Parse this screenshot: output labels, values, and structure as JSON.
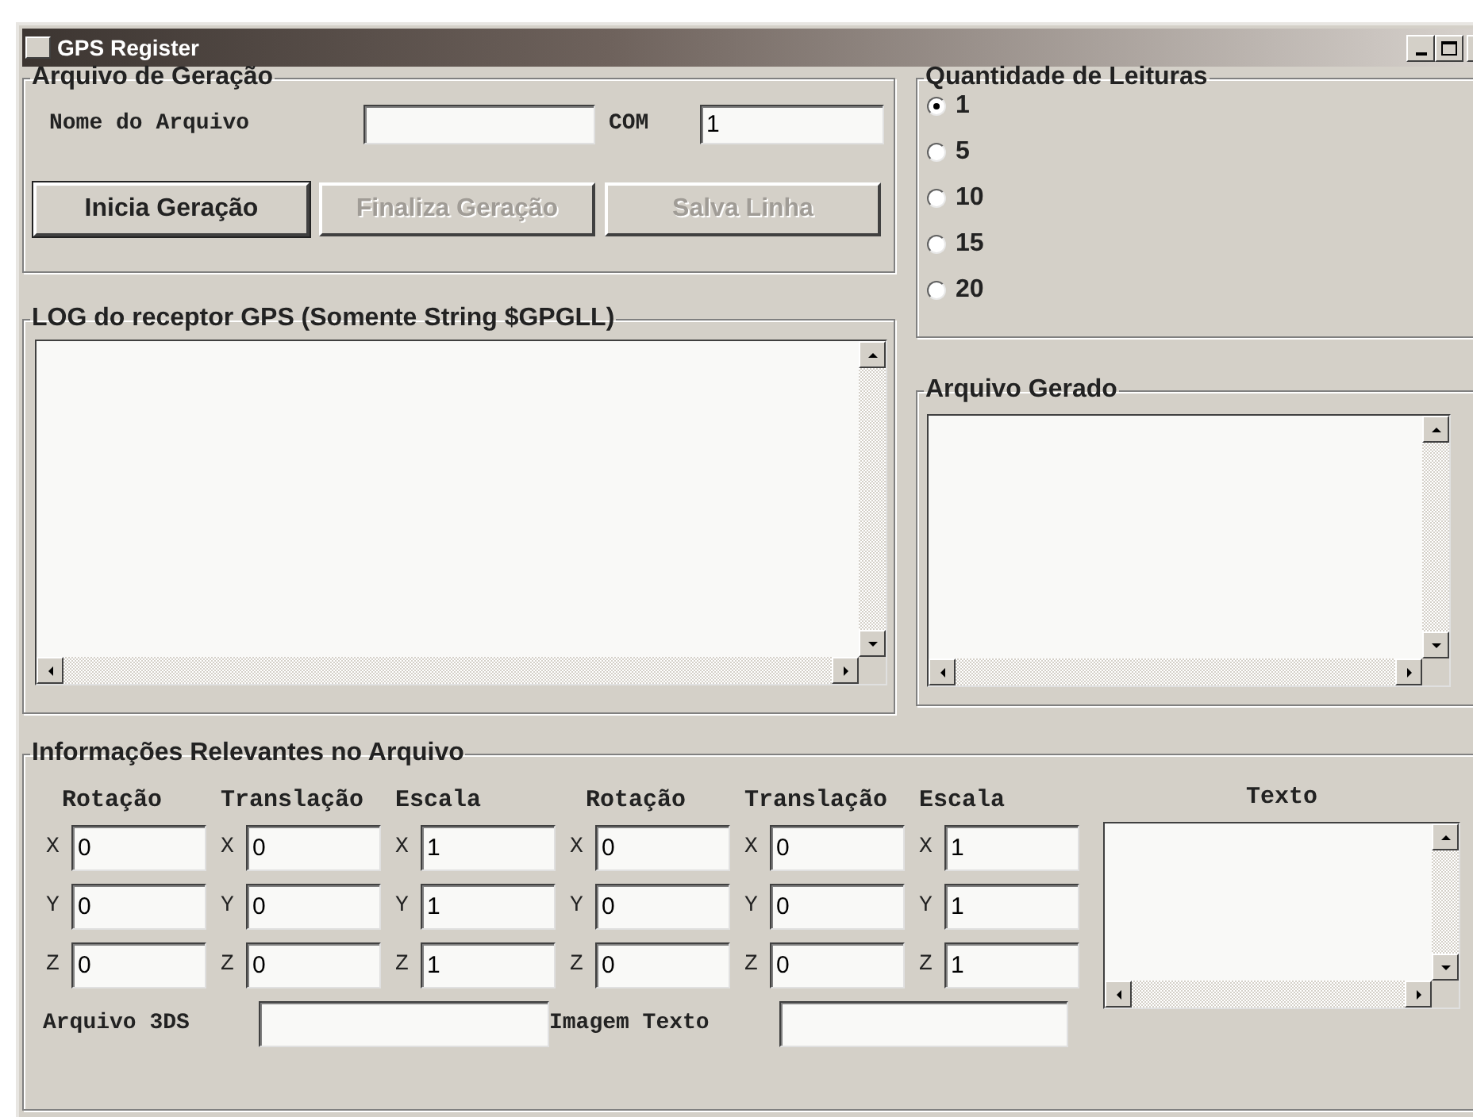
{
  "window": {
    "title": "GPS Register"
  },
  "generation": {
    "title": "Arquivo de Geração",
    "file_name_label": "Nome do Arquivo",
    "com_label": "COM",
    "com_value": "1",
    "buttons": [
      {
        "label": "Inicia Geração",
        "disabled": false
      },
      {
        "label": "Finaliza Geração",
        "disabled": true
      },
      {
        "label": "Salva Linha",
        "disabled": true
      }
    ]
  },
  "log": {
    "title": "LOG do receptor GPS (Somente String $GPGLL)"
  },
  "readings": {
    "title": "Quantidade de Leituras",
    "options": [
      {
        "label": "1",
        "selected": true
      },
      {
        "label": "5",
        "selected": false
      },
      {
        "label": "10",
        "selected": false
      },
      {
        "label": "15",
        "selected": false
      },
      {
        "label": "20",
        "selected": false
      }
    ]
  },
  "generated_file": {
    "title": "Arquivo Gerado"
  },
  "info": {
    "title": "Informações Relevantes no Arquivo",
    "columns": [
      {
        "header": "Rotação",
        "fields": [
          {
            "axis": "X",
            "value": "0"
          },
          {
            "axis": "Y",
            "value": "0"
          },
          {
            "axis": "Z",
            "value": "0"
          }
        ]
      },
      {
        "header": "Translação",
        "fields": [
          {
            "axis": "X",
            "value": "0"
          },
          {
            "axis": "Y",
            "value": "0"
          },
          {
            "axis": "Z",
            "value": "0"
          }
        ]
      },
      {
        "header": "Escala",
        "fields": [
          {
            "axis": "X",
            "value": "1"
          },
          {
            "axis": "Y",
            "value": "1"
          },
          {
            "axis": "Z",
            "value": "1"
          }
        ]
      },
      {
        "header": "Rotação",
        "fields": [
          {
            "axis": "X",
            "value": "0"
          },
          {
            "axis": "Y",
            "value": "0"
          },
          {
            "axis": "Z",
            "value": "0"
          }
        ]
      },
      {
        "header": "Translação",
        "fields": [
          {
            "axis": "X",
            "value": "0"
          },
          {
            "axis": "Y",
            "value": "0"
          },
          {
            "axis": "Z",
            "value": "0"
          }
        ]
      },
      {
        "header": "Escala",
        "fields": [
          {
            "axis": "X",
            "value": "1"
          },
          {
            "axis": "Y",
            "value": "1"
          },
          {
            "axis": "Z",
            "value": "1"
          }
        ]
      }
    ],
    "text_label": "Texto",
    "file_3ds_label": "Arquivo 3DS",
    "image_text_label": "Imagem Texto"
  }
}
